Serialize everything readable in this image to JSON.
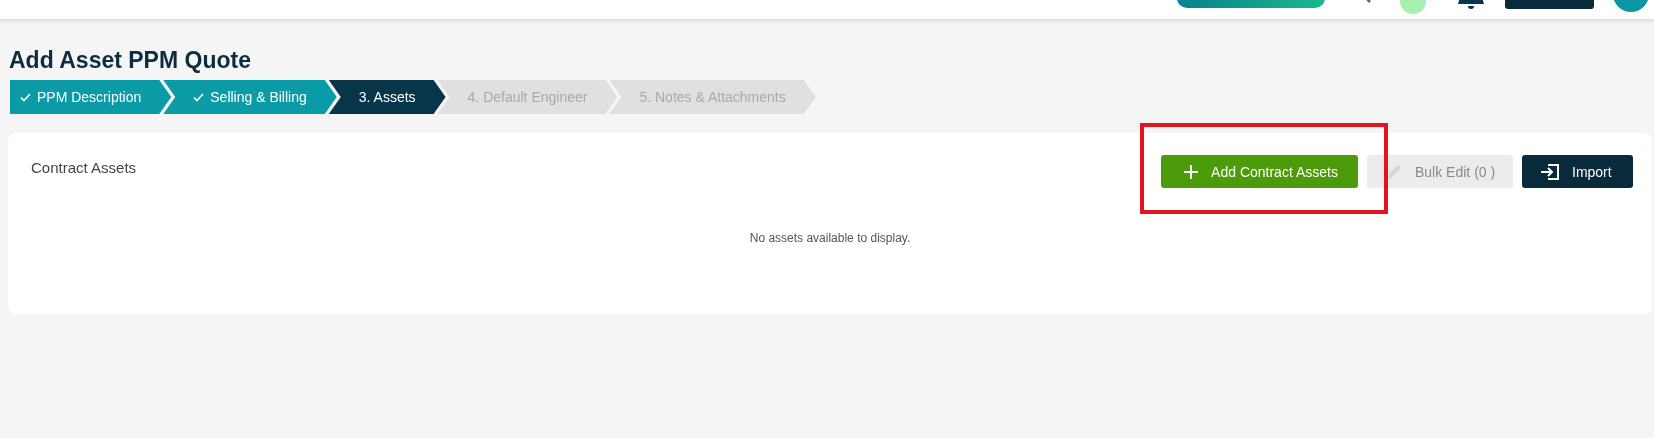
{
  "page_title": "Add Asset PPM Quote",
  "steps": [
    {
      "label": "PPM Description",
      "completed": true,
      "selected": false
    },
    {
      "label": "Selling & Billing",
      "completed": true,
      "selected": false
    },
    {
      "label": "3. Assets",
      "completed": false,
      "selected": true
    },
    {
      "label": "4. Default Engineer",
      "completed": false,
      "selected": false
    },
    {
      "label": "5. Notes & Attachments",
      "completed": false,
      "selected": false
    }
  ],
  "card": {
    "title": "Contract Assets",
    "empty_message": "No assets available to display.",
    "buttons": [
      {
        "kind": "add",
        "label": "Add Contract Assets",
        "disabled": false
      },
      {
        "kind": "edit",
        "label": "Bulk Edit (0 )",
        "disabled": true
      },
      {
        "kind": "import",
        "label": "Import",
        "disabled": false
      }
    ]
  }
}
